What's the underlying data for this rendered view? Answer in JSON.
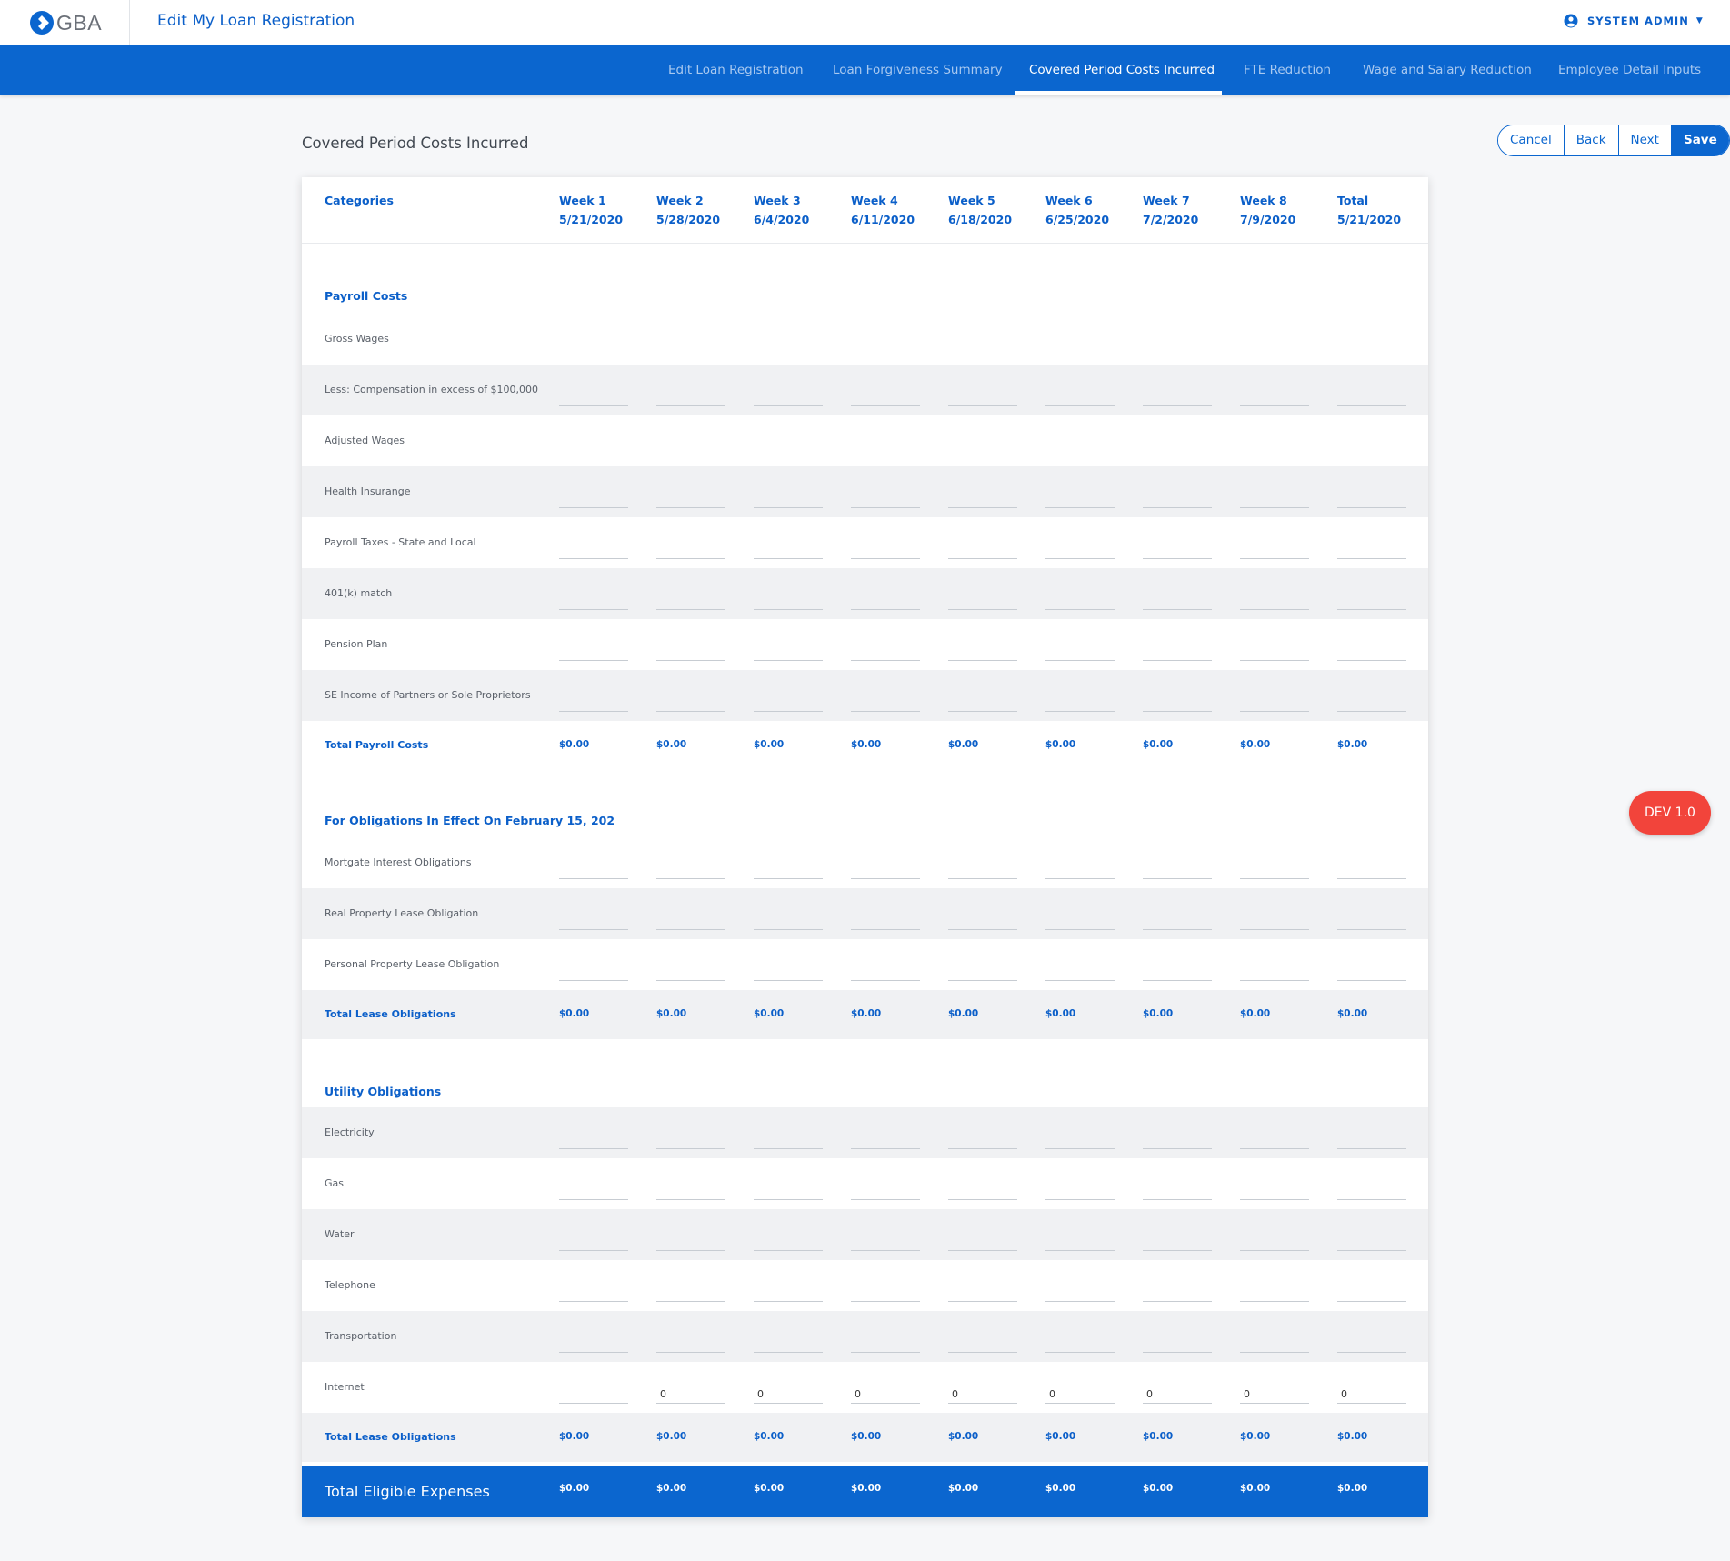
{
  "header": {
    "logo_text": "GBA",
    "app_title": "Edit My Loan Registration",
    "user_label": "SYSTEM ADMIN"
  },
  "nav": {
    "tabs": [
      {
        "label": "Edit Loan Registration",
        "active": false
      },
      {
        "label": "Loan Forgiveness Summary",
        "active": false
      },
      {
        "label": "Covered Period Costs Incurred",
        "active": true
      },
      {
        "label": "FTE Reduction",
        "active": false
      },
      {
        "label": "Wage and Salary Reduction",
        "active": false
      },
      {
        "label": "Employee Detail Inputs",
        "active": false
      }
    ]
  },
  "page": {
    "title": "Covered Period Costs Incurred",
    "buttons": {
      "cancel": "Cancel",
      "back": "Back",
      "next": "Next",
      "save": "Save"
    },
    "dev_badge": "DEV 1.0"
  },
  "table": {
    "categories_label": "Categories",
    "columns": [
      {
        "name": "Week 1",
        "date": "5/21/2020"
      },
      {
        "name": "Week 2",
        "date": "5/28/2020"
      },
      {
        "name": "Week 3",
        "date": "6/4/2020"
      },
      {
        "name": "Week 4",
        "date": "6/11/2020"
      },
      {
        "name": "Week 5",
        "date": "6/18/2020"
      },
      {
        "name": "Week 6",
        "date": "6/25/2020"
      },
      {
        "name": "Week 7",
        "date": "7/2/2020"
      },
      {
        "name": "Week 8",
        "date": "7/9/2020"
      },
      {
        "name": "Total",
        "date": "5/21/2020"
      }
    ],
    "sections": [
      {
        "title": "Payroll Costs",
        "rows": [
          {
            "label": "Gross Wages",
            "inputs": true,
            "values": [
              "",
              "",
              "",
              "",
              "",
              "",
              "",
              "",
              ""
            ]
          },
          {
            "label": "Less: Compensation in excess of $100,000",
            "inputs": true,
            "values": [
              "",
              "",
              "",
              "",
              "",
              "",
              "",
              "",
              ""
            ]
          },
          {
            "label": "Adjusted Wages",
            "inputs": false,
            "values": []
          },
          {
            "label": "Health Insurange",
            "inputs": true,
            "values": [
              "",
              "",
              "",
              "",
              "",
              "",
              "",
              "",
              ""
            ]
          },
          {
            "label": "Payroll Taxes - State and Local",
            "inputs": true,
            "values": [
              "",
              "",
              "",
              "",
              "",
              "",
              "",
              "",
              ""
            ]
          },
          {
            "label": "401(k) match",
            "inputs": true,
            "values": [
              "",
              "",
              "",
              "",
              "",
              "",
              "",
              "",
              ""
            ]
          },
          {
            "label": "Pension Plan",
            "inputs": true,
            "values": [
              "",
              "",
              "",
              "",
              "",
              "",
              "",
              "",
              ""
            ]
          },
          {
            "label": "SE Income of Partners or Sole Proprietors",
            "inputs": true,
            "values": [
              "",
              "",
              "",
              "",
              "",
              "",
              "",
              "",
              ""
            ]
          }
        ],
        "total": {
          "label": "Total Payroll Costs",
          "values": [
            "$0.00",
            "$0.00",
            "$0.00",
            "$0.00",
            "$0.00",
            "$0.00",
            "$0.00",
            "$0.00",
            "$0.00"
          ]
        }
      },
      {
        "title": "For Obligations In Effect On February 15, 202",
        "rows": [
          {
            "label": "Mortgate Interest Obligations",
            "inputs": true,
            "values": [
              "",
              "",
              "",
              "",
              "",
              "",
              "",
              "",
              ""
            ]
          },
          {
            "label": "Real Property Lease Obligation",
            "inputs": true,
            "values": [
              "",
              "",
              "",
              "",
              "",
              "",
              "",
              "",
              ""
            ]
          },
          {
            "label": "Personal Property Lease Obligation",
            "inputs": true,
            "values": [
              "",
              "",
              "",
              "",
              "",
              "",
              "",
              "",
              ""
            ]
          }
        ],
        "total": {
          "label": "Total Lease Obligations",
          "values": [
            "$0.00",
            "$0.00",
            "$0.00",
            "$0.00",
            "$0.00",
            "$0.00",
            "$0.00",
            "$0.00",
            "$0.00"
          ]
        }
      },
      {
        "title": "Utility Obligations",
        "rows": [
          {
            "label": "Electricity",
            "inputs": true,
            "values": [
              "",
              "",
              "",
              "",
              "",
              "",
              "",
              "",
              ""
            ]
          },
          {
            "label": "Gas",
            "inputs": true,
            "values": [
              "",
              "",
              "",
              "",
              "",
              "",
              "",
              "",
              ""
            ]
          },
          {
            "label": "Water",
            "inputs": true,
            "values": [
              "",
              "",
              "",
              "",
              "",
              "",
              "",
              "",
              ""
            ]
          },
          {
            "label": "Telephone",
            "inputs": true,
            "values": [
              "",
              "",
              "",
              "",
              "",
              "",
              "",
              "",
              ""
            ]
          },
          {
            "label": "Transportation",
            "inputs": true,
            "values": [
              "",
              "",
              "",
              "",
              "",
              "",
              "",
              "",
              ""
            ]
          },
          {
            "label": "Internet",
            "inputs": true,
            "values": [
              "",
              "0",
              "0",
              "0",
              "0",
              "0",
              "0",
              "0",
              "0"
            ]
          }
        ],
        "total": {
          "label": "Total Lease Obligations",
          "values": [
            "$0.00",
            "$0.00",
            "$0.00",
            "$0.00",
            "$0.00",
            "$0.00",
            "$0.00",
            "$0.00",
            "$0.00"
          ]
        }
      }
    ],
    "grand_total": {
      "label": "Total Eligible Expenses",
      "values": [
        "$0.00",
        "$0.00",
        "$0.00",
        "$0.00",
        "$0.00",
        "$0.00",
        "$0.00",
        "$0.00",
        "$0.00"
      ]
    }
  }
}
